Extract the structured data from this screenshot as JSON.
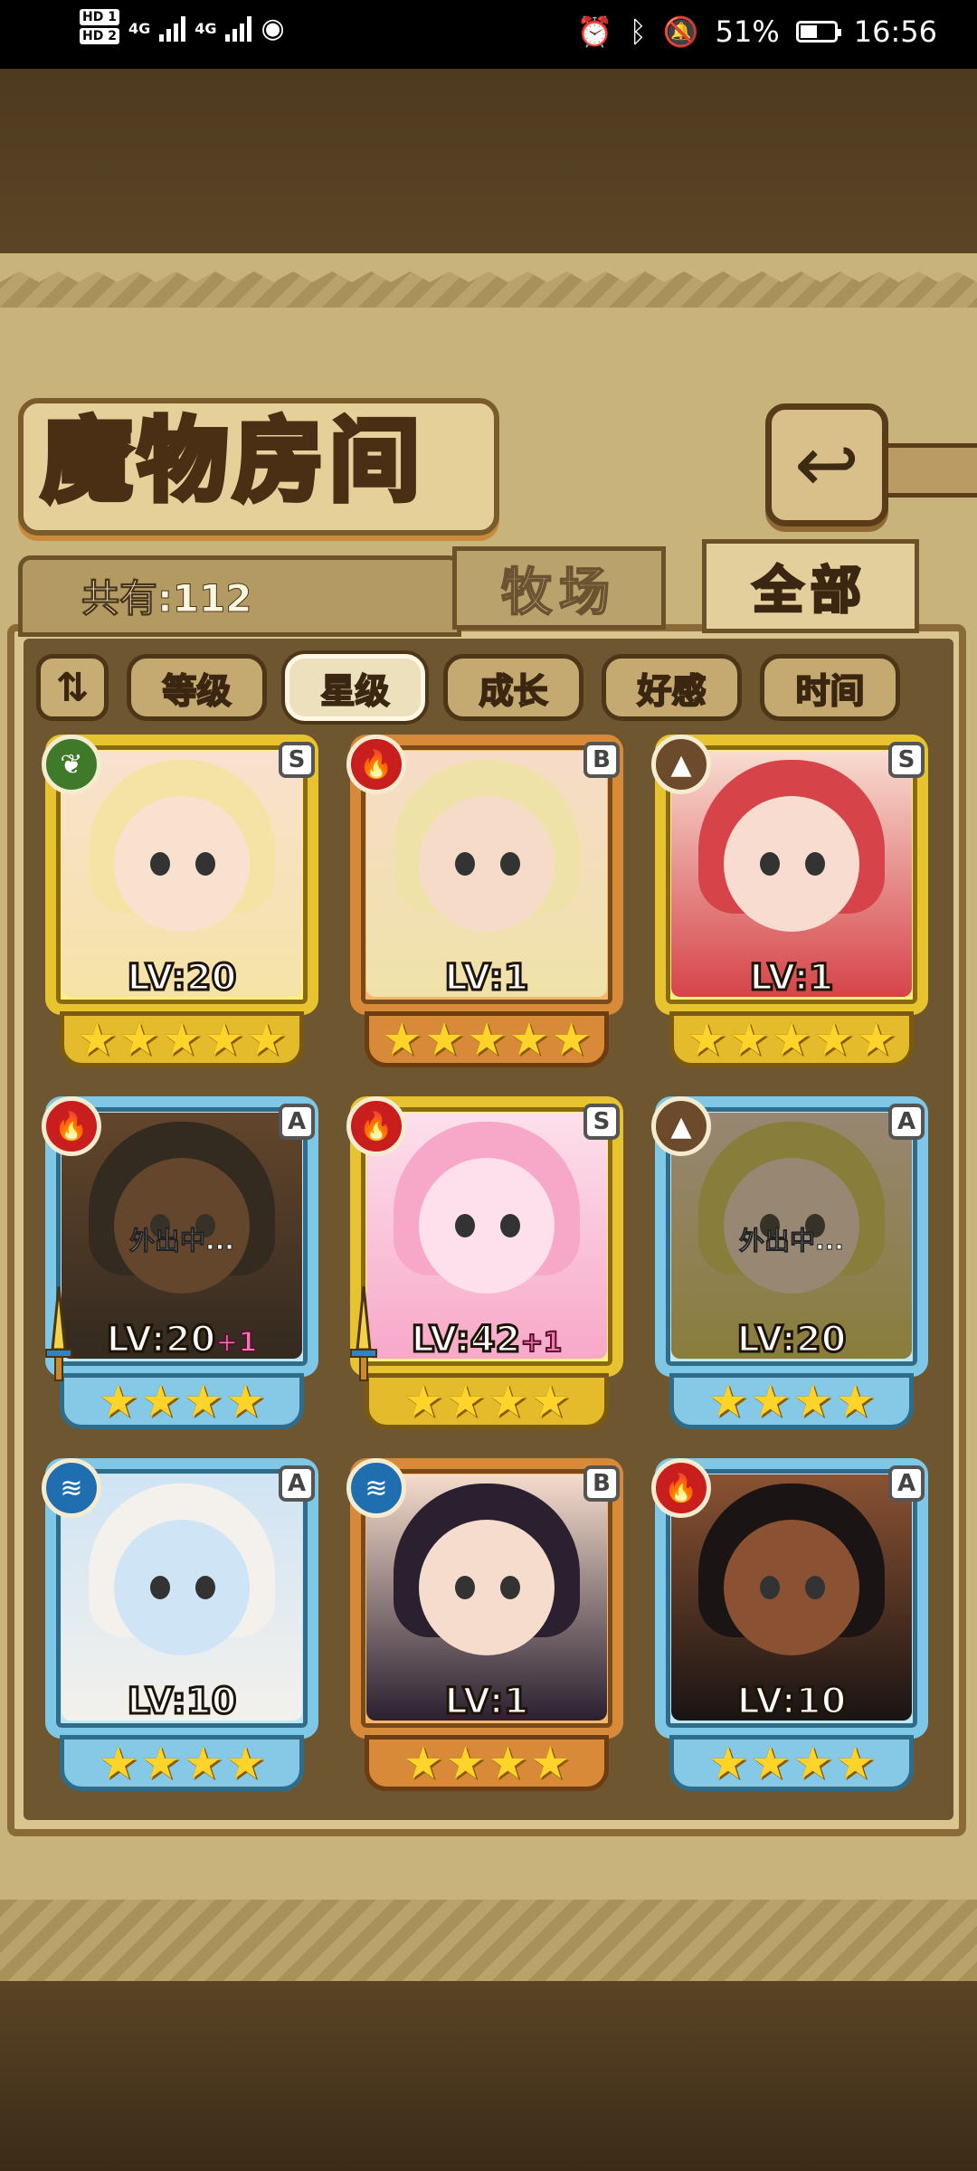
{
  "status_bar": {
    "hd1": "HD 1",
    "hd2": "HD 2",
    "net1": "4G",
    "net2": "4G",
    "battery_percent": "51%",
    "battery_level": 0.51,
    "time": "16:56"
  },
  "header": {
    "title": "魔物房间",
    "back_icon": "return-arrow-icon"
  },
  "count": {
    "text": "共有:112"
  },
  "tabs": [
    {
      "label": "牧场",
      "active": false
    },
    {
      "label": "全部",
      "active": true
    }
  ],
  "sort": {
    "toggle_icon": "sort-order-icon",
    "buttons": [
      {
        "label": "等级",
        "active": false
      },
      {
        "label": "星级",
        "active": true
      },
      {
        "label": "成长",
        "active": false
      },
      {
        "label": "好感",
        "active": false
      },
      {
        "label": "时间",
        "active": false
      }
    ]
  },
  "monsters": [
    {
      "element": "grass",
      "rank": "S",
      "level": "LV:20",
      "bonus": "",
      "stars": 5,
      "frame": "gold",
      "out": "",
      "palette": [
        "#f5e3a6",
        "#f8e1cf"
      ]
    },
    {
      "element": "fire",
      "rank": "B",
      "level": "LV:1",
      "bonus": "",
      "stars": 5,
      "frame": "bronze",
      "out": "",
      "palette": [
        "#efe2a8",
        "#f6dcc8"
      ]
    },
    {
      "element": "earth",
      "rank": "S",
      "level": "LV:1",
      "bonus": "",
      "stars": 5,
      "frame": "gold",
      "out": "",
      "palette": [
        "#d6444a",
        "#f8dcd0"
      ]
    },
    {
      "element": "fire",
      "rank": "A",
      "level": "LV:20",
      "bonus": "+1",
      "stars": 4,
      "frame": "blue",
      "out": "外出中...",
      "palette": [
        "#2b2222",
        "#8a5a3a"
      ]
    },
    {
      "element": "fire",
      "rank": "S",
      "level": "LV:42",
      "bonus": "+1",
      "stars": 4,
      "frame": "gold",
      "out": "",
      "palette": [
        "#f7a8c8",
        "#fde0ec"
      ]
    },
    {
      "element": "earth",
      "rank": "A",
      "level": "LV:20",
      "bonus": "",
      "stars": 4,
      "frame": "blue",
      "out": "外出中...",
      "palette": [
        "#d7c85a",
        "#f3dcc8"
      ]
    },
    {
      "element": "water",
      "rank": "A",
      "level": "LV:10",
      "bonus": "",
      "stars": 4,
      "frame": "blue",
      "out": "",
      "palette": [
        "#f4f1ec",
        "#cfe4f4"
      ]
    },
    {
      "element": "water",
      "rank": "B",
      "level": "LV:1",
      "bonus": "",
      "stars": 4,
      "frame": "bronze",
      "out": "",
      "palette": [
        "#2a2030",
        "#f5dccc"
      ]
    },
    {
      "element": "fire",
      "rank": "A",
      "level": "LV:10",
      "bonus": "",
      "stars": 4,
      "frame": "blue",
      "out": "",
      "palette": [
        "#1a1414",
        "#8a5232"
      ]
    }
  ],
  "element_icons": {
    "grass": "leaf-icon",
    "fire": "flame-icon",
    "earth": "mountain-icon",
    "water": "water-wave-icon"
  },
  "colors": {
    "parchment": "#c8b47a",
    "gold_frame": "#e8c330",
    "bronze_frame": "#d98a38",
    "blue_frame": "#7ec7e6"
  }
}
